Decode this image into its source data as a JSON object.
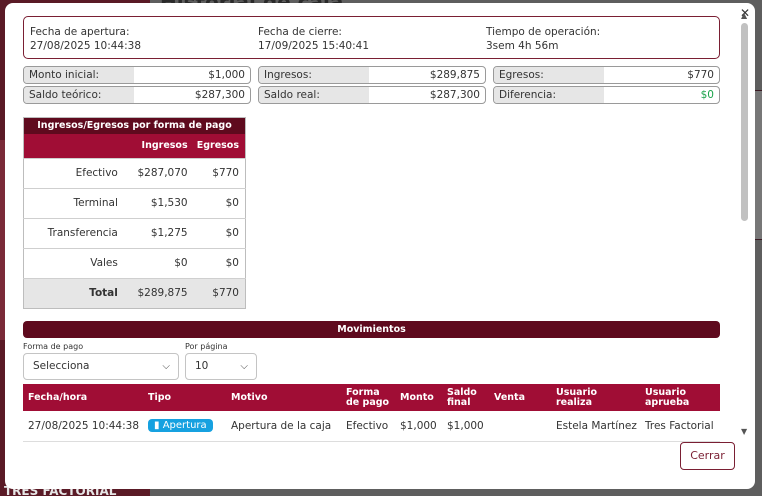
{
  "background": {
    "title": "Historial de caja",
    "logo": "TRES FACTORIAL"
  },
  "summary_dates": {
    "opening_label": "Fecha de apertura:",
    "opening_value": "27/08/2025 10:44:38",
    "closing_label": "Fecha de cierre:",
    "closing_value": "17/09/2025 15:40:41",
    "operation_label": "Tiempo de operación:",
    "operation_value": "3sem 4h 56m"
  },
  "summary_fields": {
    "monto_inicial_label": "Monto inicial:",
    "monto_inicial_value": "$1,000",
    "ingresos_label": "Ingresos:",
    "ingresos_value": "$289,875",
    "egresos_label": "Egresos:",
    "egresos_value": "$770",
    "saldo_teorico_label": "Saldo teórico:",
    "saldo_teorico_value": "$287,300",
    "saldo_real_label": "Saldo real:",
    "saldo_real_value": "$287,300",
    "diferencia_label": "Diferencia:",
    "diferencia_value": "$0",
    "diferencia_color": "#1aa34a"
  },
  "payment_table": {
    "title": "Ingresos/Egresos por forma de pago",
    "col_ingresos": "Ingresos",
    "col_egresos": "Egresos",
    "rows": [
      {
        "method": "Efectivo",
        "ingresos": "$287,070",
        "egresos": "$770"
      },
      {
        "method": "Terminal",
        "ingresos": "$1,530",
        "egresos": "$0"
      },
      {
        "method": "Transferencia",
        "ingresos": "$1,275",
        "egresos": "$0"
      },
      {
        "method": "Vales",
        "ingresos": "$0",
        "egresos": "$0"
      }
    ],
    "total": {
      "method": "Total",
      "ingresos": "$289,875",
      "egresos": "$770"
    }
  },
  "movements": {
    "title": "Movimientos",
    "filter_payment_label": "Forma de pago",
    "filter_payment_value": "Selecciona",
    "filter_page_label": "Por página",
    "filter_page_value": "10",
    "columns": {
      "fecha": "Fecha/hora",
      "tipo": "Tipo",
      "motivo": "Motivo",
      "forma_1": "Forma",
      "forma_2": "de pago",
      "monto": "Monto",
      "saldo_1": "Saldo",
      "saldo_2": "final",
      "venta": "Venta",
      "usuario_r_1": "Usuario",
      "usuario_r_2": "realiza",
      "usuario_a_1": "Usuario",
      "usuario_a_2": "aprueba"
    },
    "rows": [
      {
        "fecha": "27/08/2025 10:44:38",
        "tipo": "Apertura",
        "tipo_icon": "door-icon",
        "tipo_color": "#16a1e0",
        "motivo": "Apertura de la caja",
        "forma": "Efectivo",
        "monto": "$1,000",
        "saldo": "$1,000",
        "venta": "",
        "usuario_realiza": "Estela Martínez",
        "usuario_aprueba": "Tres Factorial"
      }
    ]
  },
  "buttons": {
    "close": "Cerrar"
  },
  "colors": {
    "brand_dark": "#5f0a1e",
    "brand": "#a00d35",
    "badge_blue": "#16a1e0",
    "positive": "#1aa34a"
  }
}
